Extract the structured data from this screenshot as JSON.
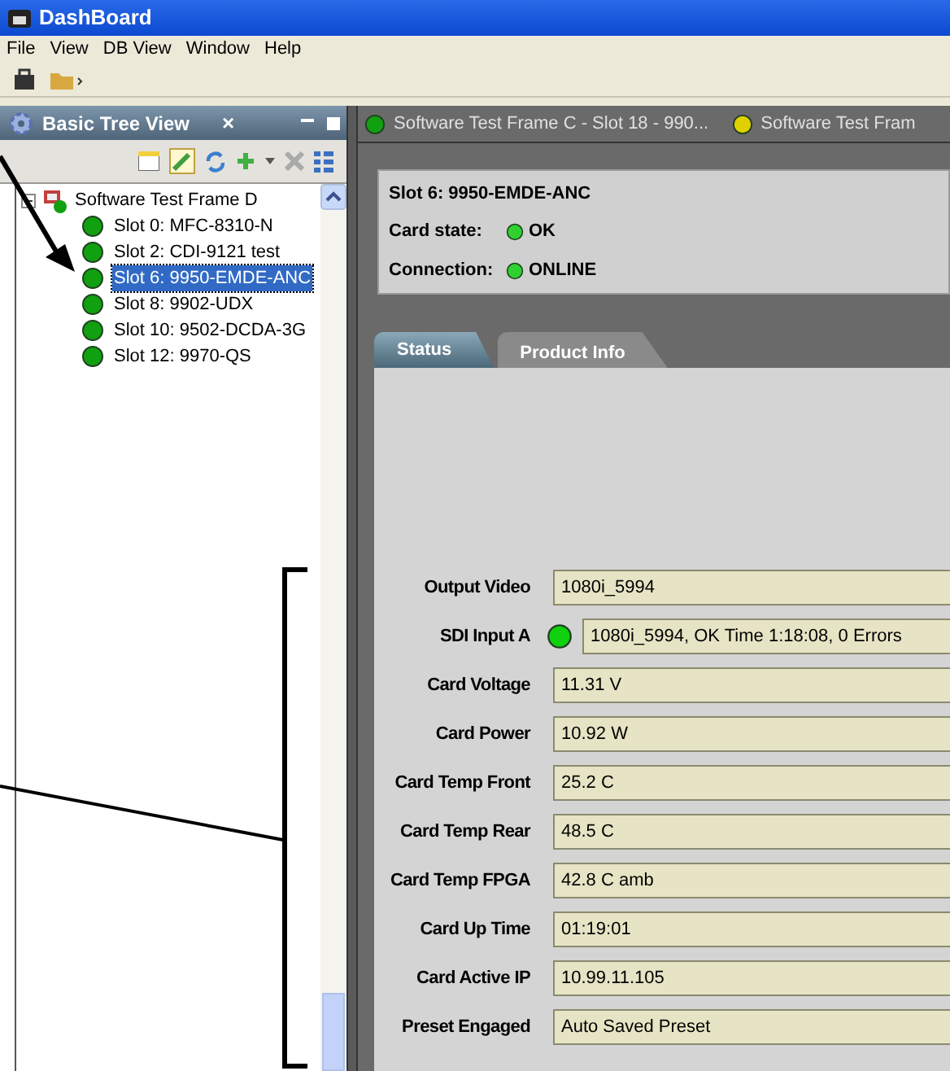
{
  "window": {
    "title": "DashBoard"
  },
  "menu": [
    "File",
    "View",
    "DB View",
    "Window",
    "Help"
  ],
  "tree_panel": {
    "title": "Basic Tree View",
    "close": "×",
    "root": {
      "label": "Software Test Frame D",
      "expanded": true,
      "children": [
        {
          "label": "Slot 0: MFC-8310-N",
          "color": "#10a010",
          "selected": false
        },
        {
          "label": "Slot 2: CDI-9121 test",
          "color": "#10a010",
          "selected": false
        },
        {
          "label": "Slot 6: 9950-EMDE-ANC",
          "color": "#10a010",
          "selected": true
        },
        {
          "label": "Slot 8: 9902-UDX",
          "color": "#10a010",
          "selected": false
        },
        {
          "label": "Slot 10: 9502-DCDA-3G",
          "color": "#10a010",
          "selected": false
        },
        {
          "label": "Slot 12: 9970-QS",
          "color": "#10a010",
          "selected": false
        }
      ]
    }
  },
  "document_tabs": [
    {
      "label": "Software Test Frame C - Slot 18 - 990...",
      "color": "#10a010"
    },
    {
      "label": "Software Test Fram",
      "color": "#e0d000"
    }
  ],
  "card": {
    "title": "Slot 6: 9950-EMDE-ANC",
    "status": [
      {
        "label": "Card state:",
        "value": "OK",
        "color": "#30d030"
      },
      {
        "label": "Connection:",
        "value": "ONLINE",
        "color": "#30d030"
      }
    ]
  },
  "tabs": [
    {
      "label": "Status",
      "selected": true
    },
    {
      "label": "Product Info",
      "selected": false
    }
  ],
  "fields": [
    {
      "kind": "text",
      "label": "Output Video",
      "value": "1080i_5994"
    },
    {
      "kind": "indicator",
      "label": "SDI Input A",
      "value": "1080i_5994, OK Time 1:18:08, 0 Errors",
      "color": "#10d010"
    },
    {
      "kind": "text",
      "label": "Card Voltage",
      "value": "11.31 V"
    },
    {
      "kind": "text",
      "label": "Card Power",
      "value": "10.92 W"
    },
    {
      "kind": "text",
      "label": "Card Temp Front",
      "value": "25.2 C"
    },
    {
      "kind": "text",
      "label": "Card Temp Rear",
      "value": "48.5 C"
    },
    {
      "kind": "text",
      "label": "Card Temp FPGA",
      "value": "42.8 C amb"
    },
    {
      "kind": "text",
      "label": "Card Up Time",
      "value": "01:19:01"
    },
    {
      "kind": "text",
      "label": "Card Active IP",
      "value": "10.99.11.105"
    },
    {
      "kind": "text",
      "label": "Preset Engaged",
      "value": "Auto Saved Preset"
    }
  ]
}
